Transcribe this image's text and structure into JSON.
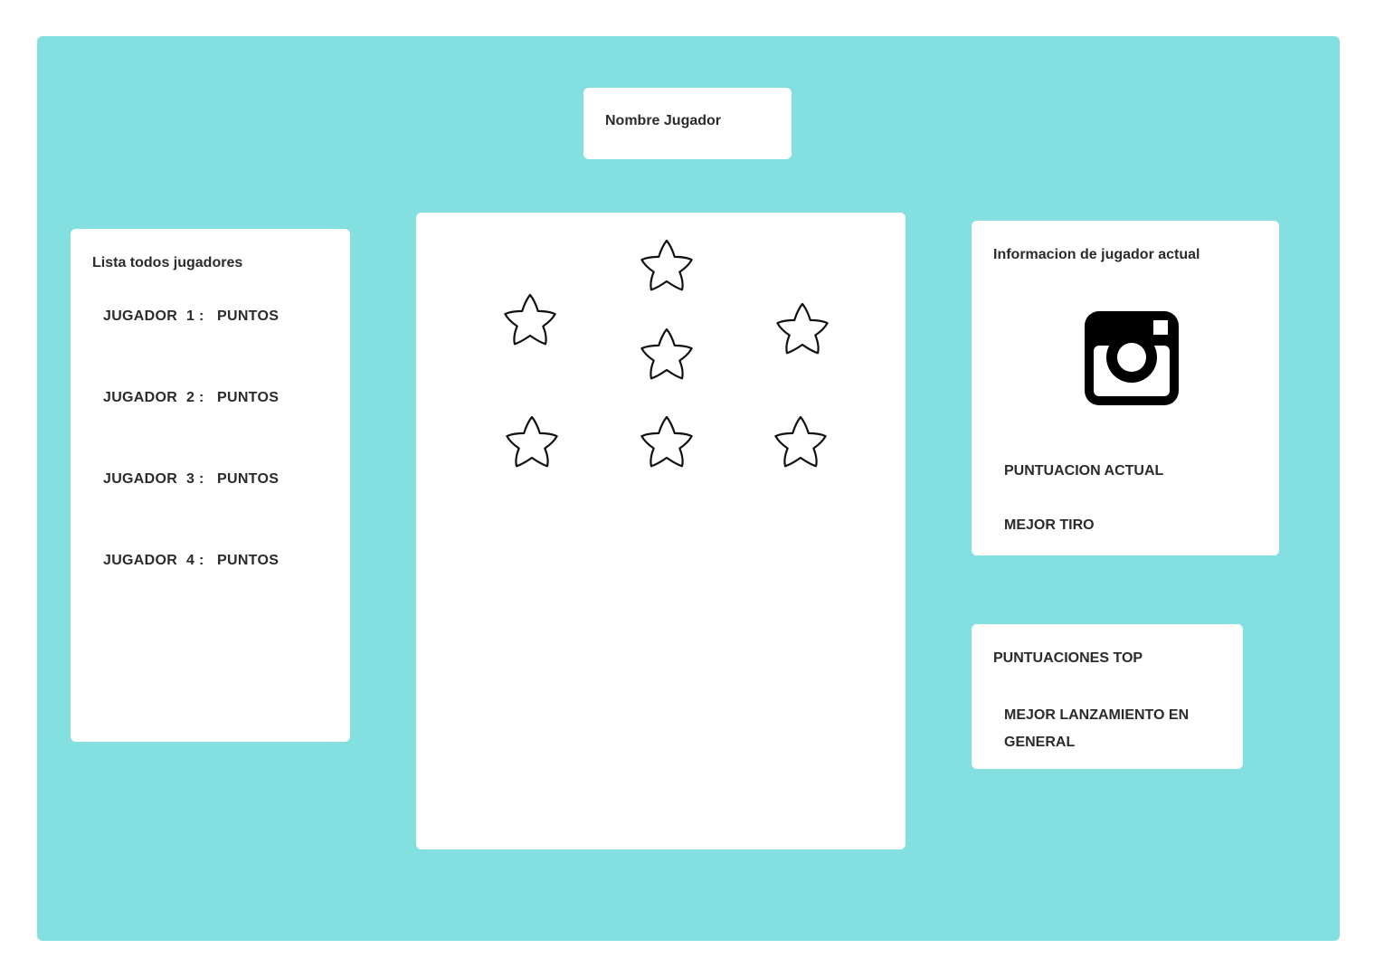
{
  "header": {
    "player_name_label": "Nombre Jugador"
  },
  "players_list": {
    "title": "Lista todos jugadores",
    "rows": [
      {
        "label": "JUGADOR",
        "number": "1 :",
        "points": "PUNTOS"
      },
      {
        "label": "JUGADOR",
        "number": "2 :",
        "points": "PUNTOS"
      },
      {
        "label": "JUGADOR",
        "number": "3 :",
        "points": "PUNTOS"
      },
      {
        "label": "JUGADOR",
        "number": "4 :",
        "points": "PUNTOS"
      }
    ]
  },
  "board": {
    "icon": "star-icon",
    "star_count": 7
  },
  "current_player": {
    "title": "Informacion de jugador actual",
    "icon": "camera-icon",
    "current_score_label": "PUNTUACION ACTUAL",
    "best_shot_label": "MEJOR TIRO"
  },
  "top_scores": {
    "title": "PUNTUACIONES TOP",
    "best_overall_label": "MEJOR LANZAMIENTO EN GENERAL"
  },
  "colors": {
    "background": "#84e0e0",
    "card": "#ffffff",
    "text": "#2b2b2b"
  }
}
